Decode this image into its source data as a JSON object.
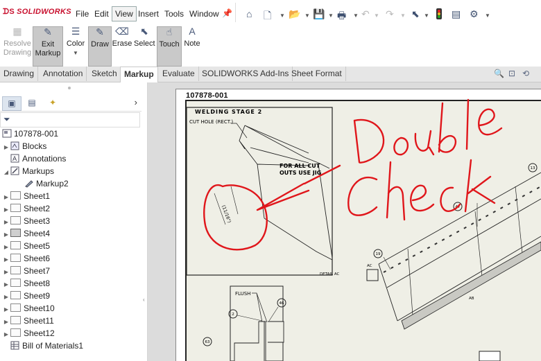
{
  "app": {
    "brand": "SOLIDWORKS"
  },
  "menu": {
    "items": [
      "File",
      "Edit",
      "View",
      "Insert",
      "Tools",
      "Window"
    ],
    "active": "View"
  },
  "ribbon": {
    "resolve_drawing": "Resolve\nDrawing",
    "exit_markup_1": "Exit",
    "exit_markup_2": "Markup",
    "color": "Color",
    "draw": "Draw",
    "erase": "Erase",
    "select": "Select",
    "touch": "Touch",
    "note": "Note"
  },
  "tabs": [
    "Drawing",
    "Annotation",
    "Sketch",
    "Markup",
    "Evaluate",
    "SOLIDWORKS Add-Ins",
    "Sheet Format"
  ],
  "active_tab": "Markup",
  "tree": {
    "root": "107878-001",
    "blocks": "Blocks",
    "annotations": "Annotations",
    "markups": "Markups",
    "markup2": "Markup2",
    "sheets": [
      "Sheet1",
      "Sheet2",
      "Sheet3",
      "Sheet4",
      "Sheet5",
      "Sheet6",
      "Sheet7",
      "Sheet8",
      "Sheet9",
      "Sheet10",
      "Sheet11",
      "Sheet12"
    ],
    "current_sheet": "Sheet4",
    "bom": "Bill of Materials1"
  },
  "drawing": {
    "number": "107878-001",
    "welding_stage": "WELDING STAGE 2",
    "cut_hole": "CUT HOLE (RECT.)",
    "jig_note_1": "FOR ALL CUT",
    "jig_note_2": "OUTS USE JIG",
    "dim_text": "(11/16\")",
    "detail": "DETAIL AC",
    "detail_tag": "AC",
    "flush": "FLUSH",
    "balloons": [
      "13",
      "47",
      "19",
      "2",
      "46",
      "63"
    ],
    "section": "AB"
  },
  "markup": {
    "handwriting_line1": "Double",
    "handwriting_line2": "Check",
    "ink_color": "#e0161b"
  }
}
